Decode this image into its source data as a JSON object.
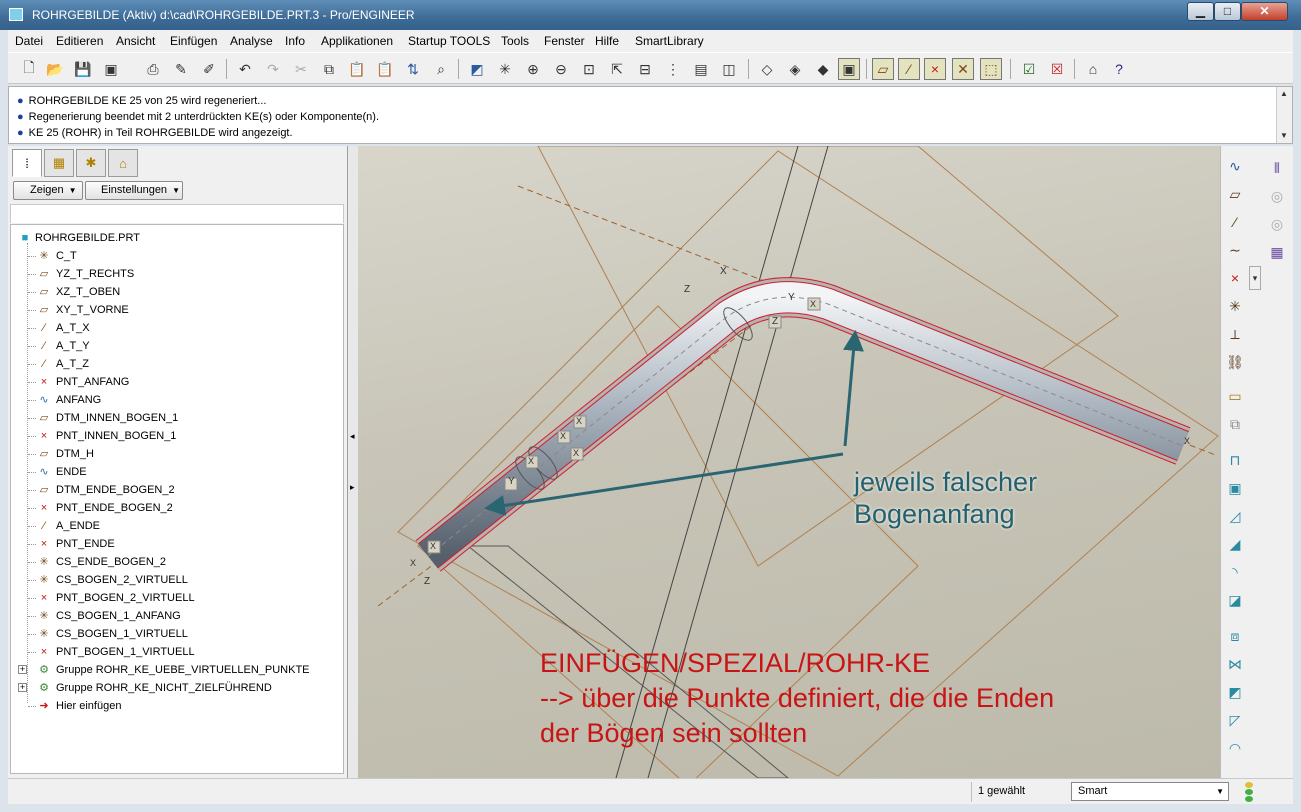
{
  "window": {
    "title": "ROHRGEBILDE (Aktiv) d:\\cad\\ROHRGEBILDE.PRT.3 - Pro/ENGINEER",
    "minimize": "▁",
    "maximize": "□",
    "close": "✕"
  },
  "menu": [
    "Datei",
    "Editieren",
    "Ansicht",
    "Einfügen",
    "Analyse",
    "Info",
    "Applikationen",
    "Startup TOOLS",
    "Tools",
    "Fenster",
    "Hilfe",
    "SmartLibrary"
  ],
  "toolbar_icons": [
    "new-file",
    "open-folder",
    "save",
    "print-setup",
    "print",
    "regenerate",
    "regenerate-manager",
    "undo",
    "redo",
    "cut",
    "copy",
    "paste",
    "paste-special",
    "flip",
    "find",
    "repaint",
    "spin-center",
    "zoom-in",
    "zoom-out",
    "refit",
    "orient",
    "saved-views",
    "layers",
    "view-manager",
    "wireframe",
    "hidden-line",
    "no-hidden",
    "shading",
    "datum-planes",
    "datum-axes",
    "datum-points",
    "coordinate-systems",
    "annotations",
    "checkbox",
    "close-window",
    "home",
    "help-whats-this"
  ],
  "messages": [
    "ROHRGEBILDE KE 25 von 25 wird regeneriert...",
    "Regenerierung beendet mit 2 unterdrückten KE(s) oder Komponente(n).",
    "KE 25 (ROHR) in Teil ROHRGEBILDE wird angezeigt."
  ],
  "nav_tabs": [
    "model-tree",
    "folder-browser",
    "favorites",
    "connections"
  ],
  "tree_buttons": {
    "show": "Zeigen",
    "settings": "Einstellungen"
  },
  "tree": {
    "root": "ROHRGEBILDE.PRT",
    "items": [
      {
        "label": "C_T",
        "icon": "csys"
      },
      {
        "label": "YZ_T_RECHTS",
        "icon": "plane"
      },
      {
        "label": "XZ_T_OBEN",
        "icon": "plane"
      },
      {
        "label": "XY_T_VORNE",
        "icon": "plane"
      },
      {
        "label": "A_T_X",
        "icon": "axis"
      },
      {
        "label": "A_T_Y",
        "icon": "axis"
      },
      {
        "label": "A_T_Z",
        "icon": "axis"
      },
      {
        "label": "PNT_ANFANG",
        "icon": "point"
      },
      {
        "label": "ANFANG",
        "icon": "curve"
      },
      {
        "label": "DTM_INNEN_BOGEN_1",
        "icon": "plane"
      },
      {
        "label": "PNT_INNEN_BOGEN_1",
        "icon": "point"
      },
      {
        "label": "DTM_H",
        "icon": "plane"
      },
      {
        "label": "ENDE",
        "icon": "curve"
      },
      {
        "label": "DTM_ENDE_BOGEN_2",
        "icon": "plane"
      },
      {
        "label": "PNT_ENDE_BOGEN_2",
        "icon": "point"
      },
      {
        "label": "A_ENDE",
        "icon": "axis"
      },
      {
        "label": "PNT_ENDE",
        "icon": "point"
      },
      {
        "label": "CS_ENDE_BOGEN_2",
        "icon": "csys"
      },
      {
        "label": "CS_BOGEN_2_VIRTUELL",
        "icon": "csys"
      },
      {
        "label": "PNT_BOGEN_2_VIRTUELL",
        "icon": "point"
      },
      {
        "label": "CS_BOGEN_1_ANFANG",
        "icon": "csys"
      },
      {
        "label": "CS_BOGEN_1_VIRTUELL",
        "icon": "csys"
      },
      {
        "label": "PNT_BOGEN_1_VIRTUELL",
        "icon": "point"
      },
      {
        "label": "Gruppe ROHR_KE_UEBE_VIRTUELLEN_PUNKTE",
        "icon": "group",
        "expandable": true
      },
      {
        "label": "Gruppe ROHR_KE_NICHT_ZIELFÜHREND",
        "icon": "group",
        "expandable": true
      },
      {
        "label": "Hier einfügen",
        "icon": "insert-arrow"
      }
    ]
  },
  "viewport": {
    "axis_labels": [
      "X",
      "Z",
      "Y",
      "Z",
      "X",
      "X",
      "X",
      "X",
      "X",
      "Y",
      "X",
      "X",
      "Z",
      "X"
    ],
    "annotation_blue": [
      "jeweils falscher",
      "Bogenanfang"
    ],
    "annotation_red": [
      "EINFÜGEN/SPEZIAL/ROHR-KE",
      "--> über die Punkte definiert, die die Enden",
      "der Bögen sein sollten"
    ],
    "colors": {
      "blue_text": "#23616e",
      "red_text": "#c81414",
      "arrow": "#2a6672",
      "pipe_outline": "#d01a3a",
      "datum_line": "#b08050"
    }
  },
  "right_toolbar_icons": [
    "sketch-tool",
    "datum-plane-tool",
    "datum-axis-tool",
    "datum-curve-tool",
    "datum-point-tool",
    "csys-tool",
    "analysis-tool",
    "link-tool",
    "annotation-tool",
    "merge-tool",
    "extrude-tool",
    "revolve-tool",
    "sweep-tool",
    "blend-tool",
    "round-tool",
    "chamfer-tool",
    "hole-tool",
    "shell-tool",
    "rib-tool",
    "draft-tool",
    "pattern-tool",
    "mirror-tool",
    "move-tool",
    "trim-tool",
    "extend-tool",
    "offset-tool",
    "thicken-tool",
    "solidify-tool",
    "intersect-tool"
  ],
  "status": {
    "selected": "1 gewählt",
    "filter": "Smart"
  }
}
